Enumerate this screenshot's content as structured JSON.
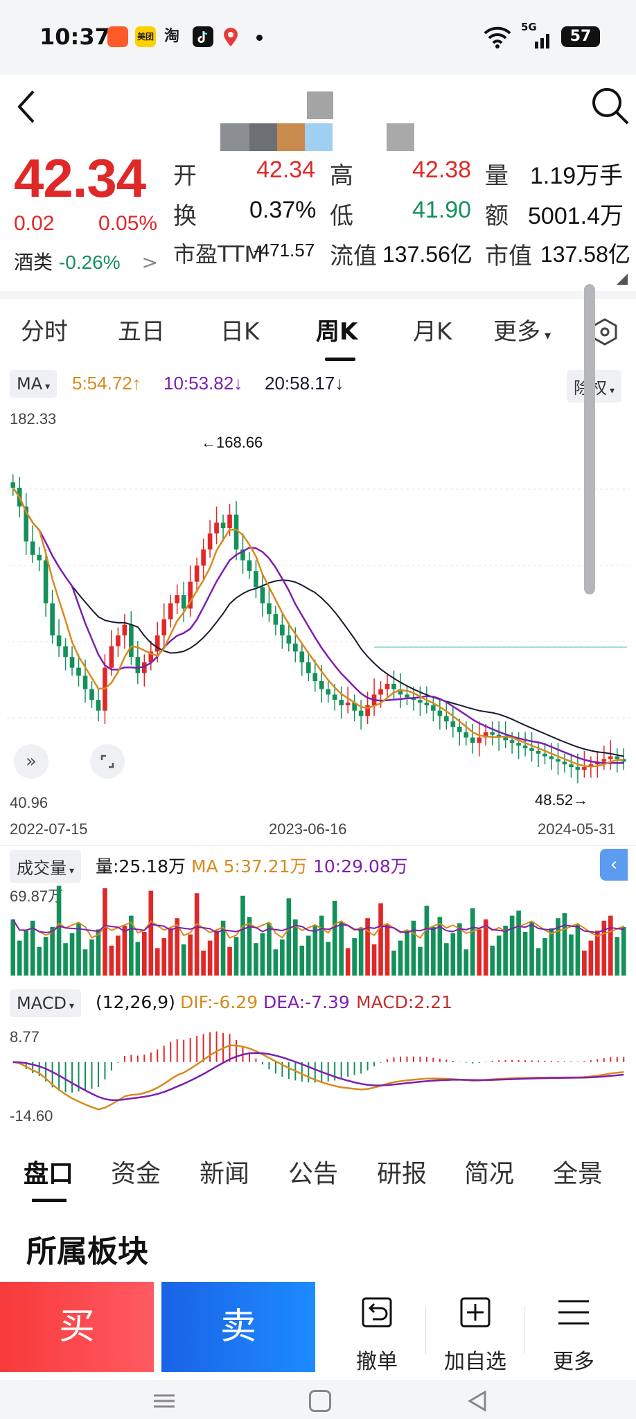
{
  "status_bar": {
    "time": "10:37",
    "app_icons": [
      "kuaishou-icon",
      "meituan-icon",
      "taobao-icon",
      "tiktok-icon",
      "map-icon"
    ],
    "meituan_label": "美团",
    "taobao_label": "淘",
    "network": "5G",
    "battery": "57"
  },
  "quote": {
    "price": "42.34",
    "change": "0.02",
    "change_pct": "0.05%",
    "sector_name": "酒类",
    "sector_change": "-0.26%",
    "sector_chevron": ">",
    "fields": [
      {
        "label": "开",
        "value": "42.34"
      },
      {
        "label": "高",
        "value": "42.38"
      },
      {
        "label": "量",
        "value": "1.19万手"
      },
      {
        "label": "换",
        "value": "0.37%"
      },
      {
        "label": "低",
        "value": "41.90"
      },
      {
        "label": "额",
        "value": "5001.4万"
      },
      {
        "label": "市盈TTM",
        "value": "-471.57"
      },
      {
        "label": "流值",
        "value": "137.56亿"
      },
      {
        "label": "市值",
        "value": "137.58亿"
      }
    ]
  },
  "chart_tabs": {
    "items": [
      "分时",
      "五日",
      "日K",
      "周K",
      "月K",
      "更多"
    ],
    "active": "周K"
  },
  "ma_bar": {
    "indicator": "MA",
    "ma5": "5:54.72↑",
    "ma10": "10:53.82↓",
    "ma20": "20:58.17↓",
    "adjust": "除权"
  },
  "colors": {
    "up": "#e02828",
    "down": "#14915a",
    "ma5": "#d98a1c",
    "ma10": "#7d1fb0",
    "ma20": "#1a1a2e",
    "accent": "#3d8df5"
  },
  "chart_data": [
    {
      "type": "candlestick",
      "title": "周K",
      "ylim": [
        40.96,
        182.33
      ],
      "y_top_label": "182.33",
      "y_bottom_label": "40.96",
      "max_marker": "←168.66",
      "min_marker": "48.52→",
      "x_labels": [
        "2022-07-15",
        "2023-06-16",
        "2024-05-31"
      ],
      "close_trend": [
        155,
        148,
        135,
        130,
        128,
        112,
        100,
        96,
        92,
        88,
        85,
        80,
        76,
        72,
        88,
        96,
        100,
        104,
        92,
        86,
        90,
        94,
        100,
        106,
        112,
        115,
        110,
        120,
        126,
        132,
        138,
        142,
        140,
        145,
        132,
        128,
        124,
        118,
        112,
        108,
        104,
        100,
        97,
        94,
        90,
        86,
        83,
        80,
        78,
        76,
        74,
        75,
        72,
        70,
        74,
        78,
        80,
        82,
        80,
        78,
        77,
        76,
        75,
        74,
        72,
        70,
        68,
        66,
        64,
        62,
        60,
        62,
        64,
        63,
        62,
        61,
        60,
        59,
        58,
        57,
        56,
        55,
        54,
        53,
        52,
        51,
        50,
        51,
        52,
        53,
        54,
        55,
        54,
        53
      ]
    },
    {
      "type": "bar",
      "title": "成交量",
      "volume_label": "量:25.18万",
      "ma5_label": "MA 5:37.21万",
      "ma10_label": "10:29.08万",
      "ymax_label": "69.87万",
      "ylim": [
        0,
        69.87
      ]
    },
    {
      "type": "bar",
      "title": "MACD",
      "params": "(12,26,9)",
      "dif_label": "DIF:-6.29",
      "dea_label": "DEA:-7.39",
      "macd_label": "MACD:2.21",
      "ymax_label": "8.77",
      "ymin_label": "-14.60",
      "ylim": [
        -14.6,
        8.77
      ]
    }
  ],
  "bottom_tabs": {
    "items": [
      "盘口",
      "资金",
      "新闻",
      "公告",
      "研报",
      "简况",
      "全景"
    ],
    "active": "盘口"
  },
  "section_title": "所属板块",
  "trade": {
    "buy": "买",
    "sell": "卖",
    "actions": [
      {
        "label": "撤单",
        "icon": "undo-icon"
      },
      {
        "label": "加自选",
        "icon": "add-favorite-icon"
      },
      {
        "label": "更多",
        "icon": "menu-icon"
      }
    ]
  }
}
